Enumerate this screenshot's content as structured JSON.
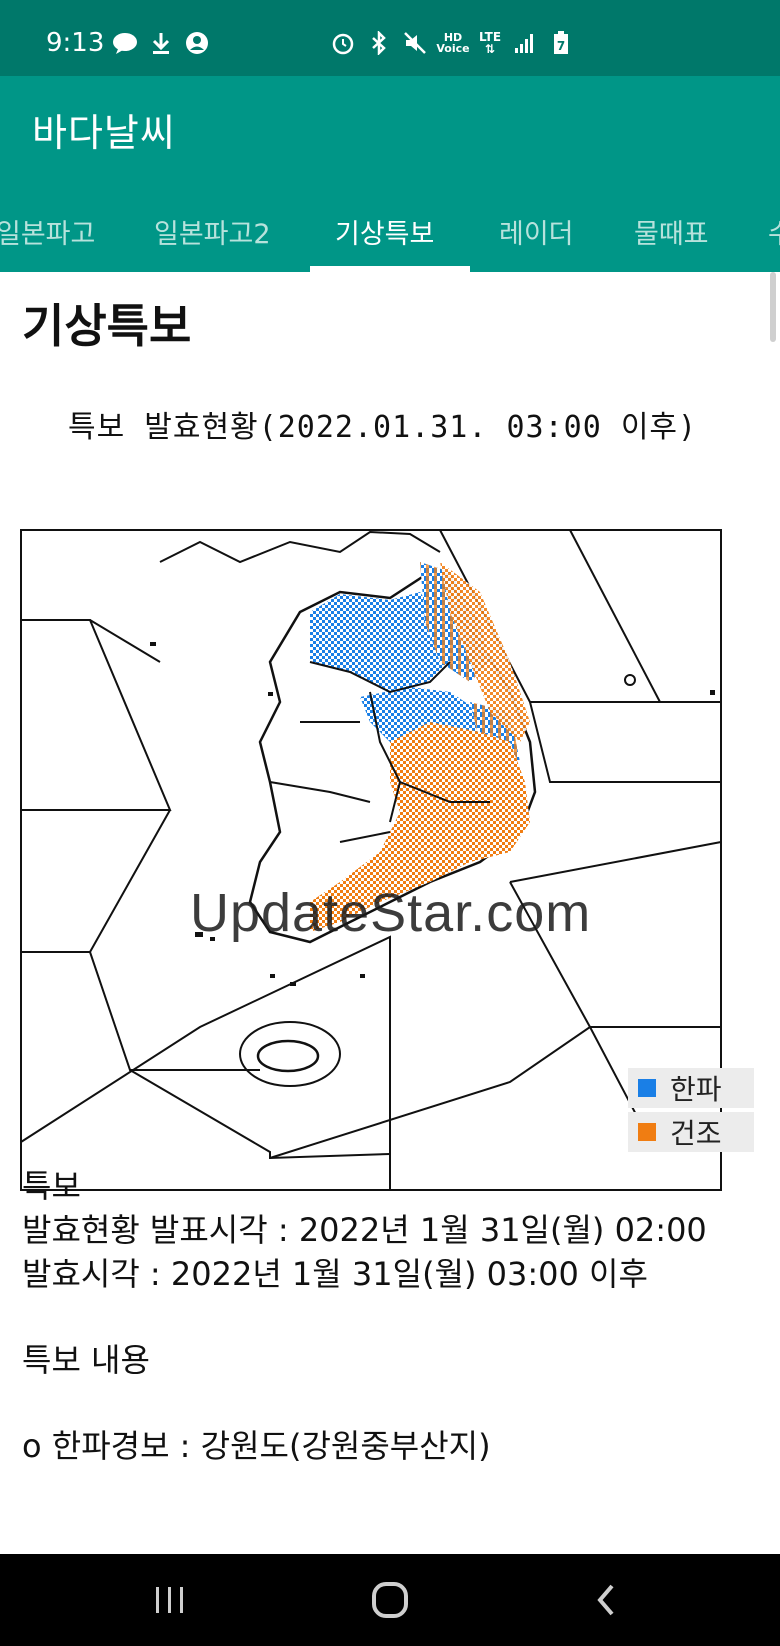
{
  "status": {
    "time": "9:13",
    "left_icons": [
      "talk-icon",
      "download-icon",
      "account-icon"
    ],
    "right_icons": [
      "alarm-icon",
      "bluetooth-icon",
      "mute-icon",
      "hd-voice-icon",
      "lte-icon",
      "signal-icon",
      "battery-icon"
    ]
  },
  "app": {
    "title": "바다날씨"
  },
  "tabs": [
    {
      "label": "일본파고",
      "active": false
    },
    {
      "label": "일본파고2",
      "active": false
    },
    {
      "label": "기상특보",
      "active": true
    },
    {
      "label": "레이더",
      "active": false
    },
    {
      "label": "물때표",
      "active": false
    },
    {
      "label": "수",
      "active": false
    }
  ],
  "page": {
    "heading": "기상특보"
  },
  "map": {
    "caption": "특보 발효현황(2022.01.31. 03:00 이후)",
    "watermark": "UpdateStar.com",
    "legend": [
      {
        "label": "한파",
        "color": "#1a7fe6"
      },
      {
        "label": "건조",
        "color": "#f07d12"
      }
    ]
  },
  "details": {
    "line1": "특보",
    "line2": "발효현황 발표시각 : 2022년 1월 31일(월) 02:00",
    "line3": "발효시각 : 2022년 1월 31일(월) 03:00 이후",
    "content_title": "특보 내용",
    "item1": "o 한파경보 : 강원도(강원중부산지)"
  },
  "navbar": {
    "buttons": [
      "recents-button",
      "home-button",
      "back-button"
    ]
  },
  "colors": {
    "status_bar": "#00786a",
    "app_bar": "#009687",
    "cold_wave": "#1a7fe6",
    "dry": "#f07d12"
  }
}
